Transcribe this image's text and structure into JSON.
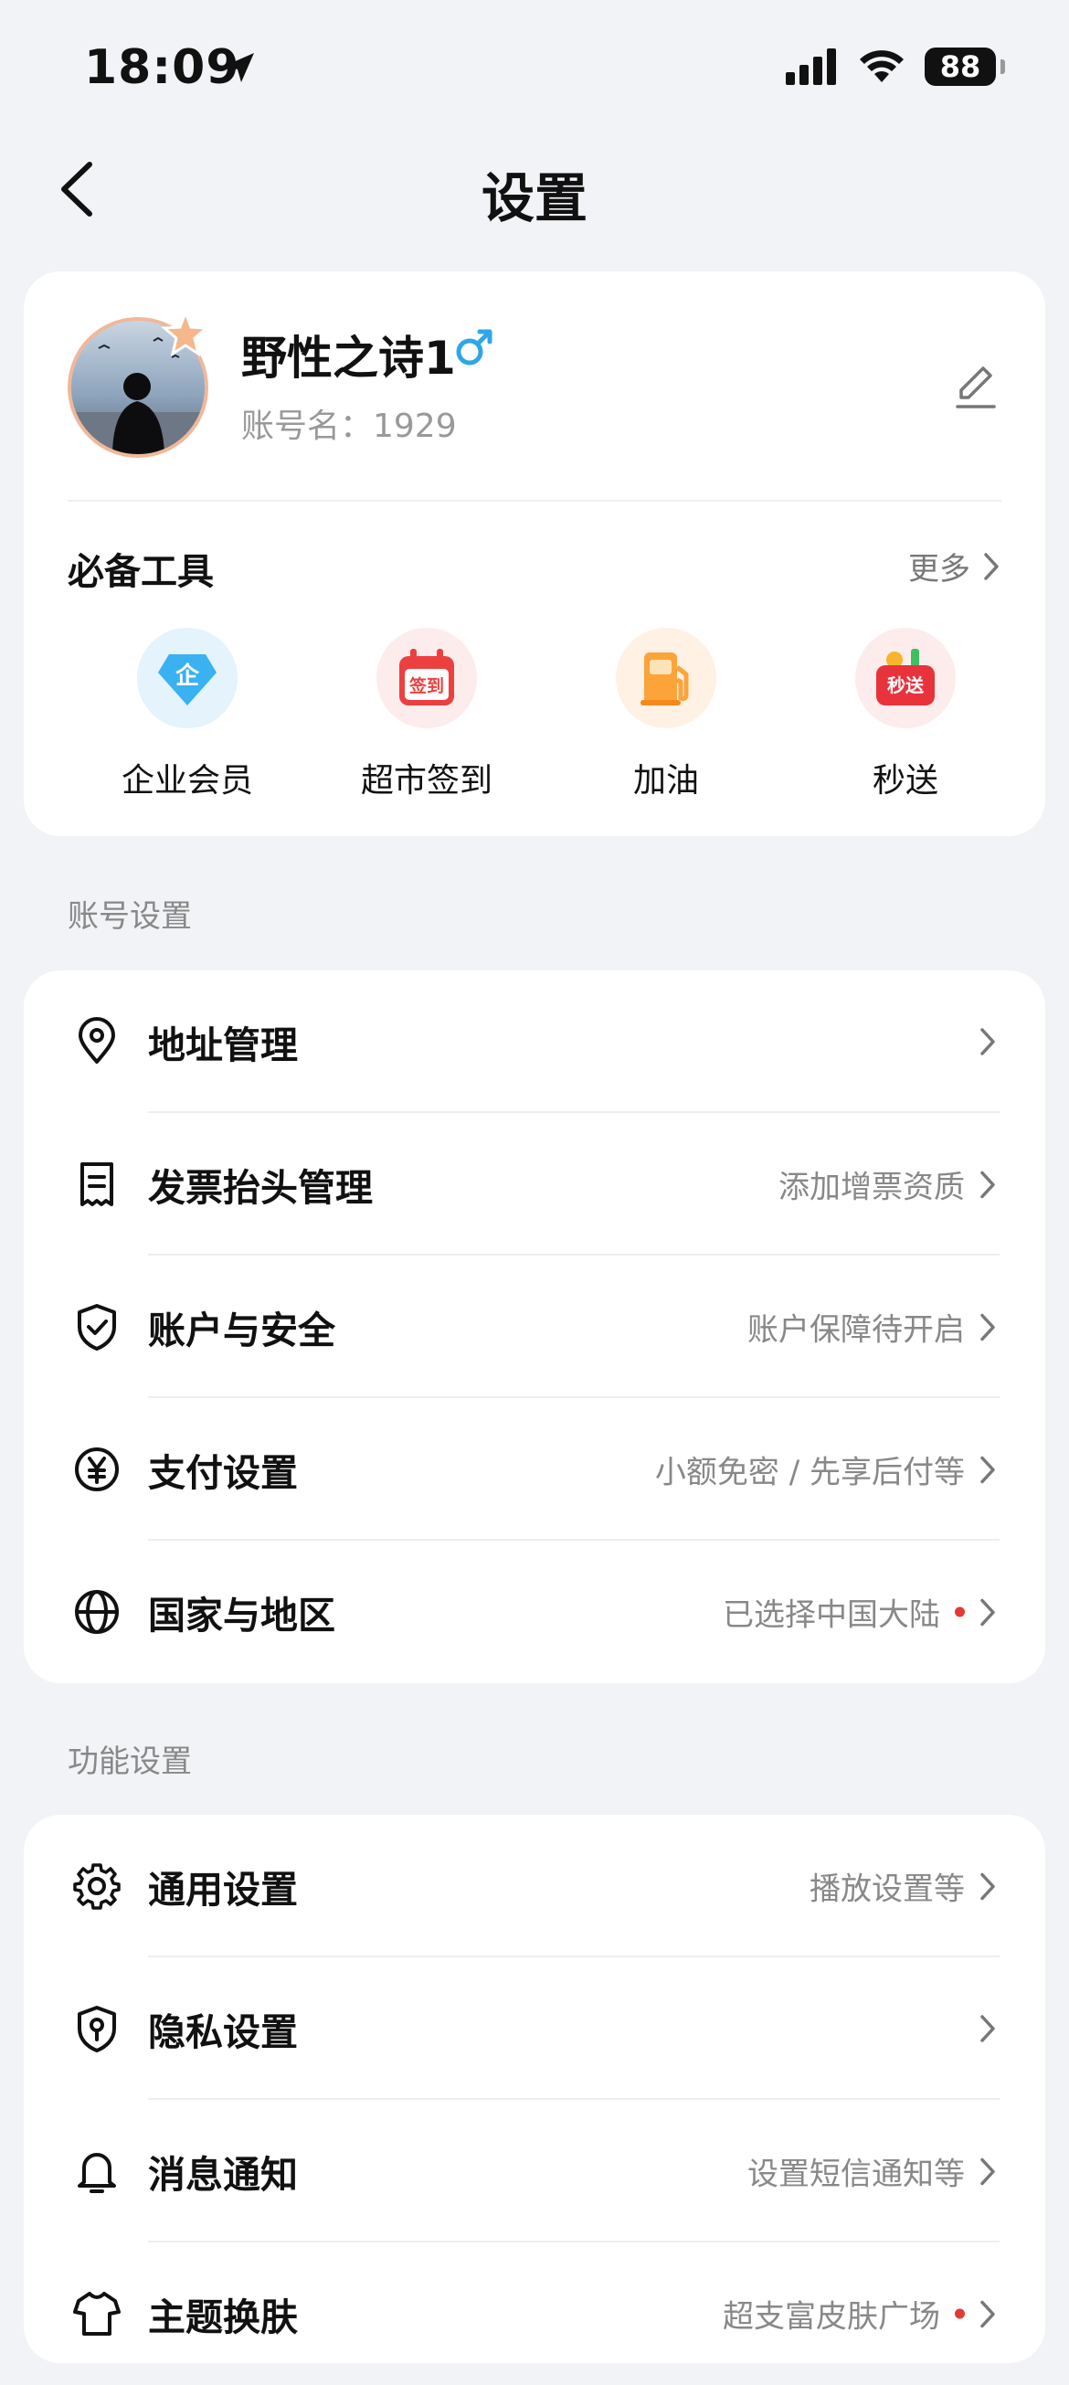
{
  "status_bar": {
    "time": "18:09",
    "battery": "88"
  },
  "nav": {
    "title": "设置"
  },
  "profile": {
    "username": "野性之诗1",
    "account_name": "账号名：1929"
  },
  "tools": {
    "title": "必备工具",
    "more": "更多",
    "items": [
      {
        "label": "企业会员",
        "icon": "enterprise-member-icon",
        "badge": "企"
      },
      {
        "label": "超市签到",
        "icon": "calendar-checkin-icon",
        "badge": "签到"
      },
      {
        "label": "加油",
        "icon": "fuel-pump-icon"
      },
      {
        "label": "秒送",
        "icon": "delivery-basket-icon",
        "badge": "秒送"
      }
    ]
  },
  "account_section": {
    "title": "账号设置",
    "rows": [
      {
        "label": "地址管理",
        "value": "",
        "icon": "location-pin-icon"
      },
      {
        "label": "发票抬头管理",
        "value": "添加增票资质",
        "icon": "invoice-icon"
      },
      {
        "label": "账户与安全",
        "value": "账户保障待开启",
        "icon": "shield-check-icon"
      },
      {
        "label": "支付设置",
        "value": "小额免密 / 先享后付等",
        "icon": "yuan-coin-icon"
      },
      {
        "label": "国家与地区",
        "value": "已选择中国大陆",
        "icon": "globe-icon",
        "dot": true
      }
    ]
  },
  "function_section": {
    "title": "功能设置",
    "rows": [
      {
        "label": "通用设置",
        "value": "播放设置等",
        "icon": "gear-icon"
      },
      {
        "label": "隐私设置",
        "value": "",
        "icon": "privacy-shield-icon"
      },
      {
        "label": "消息通知",
        "value": "设置短信通知等",
        "icon": "bell-icon"
      },
      {
        "label": "主题换肤",
        "value": "超支富皮肤广场",
        "icon": "tshirt-icon",
        "dot": true
      }
    ]
  },
  "colors": {
    "background": "#f1f3f6",
    "card": "#ffffff",
    "gender_blue": "#2fa6e8",
    "red_dot": "#e53935"
  }
}
